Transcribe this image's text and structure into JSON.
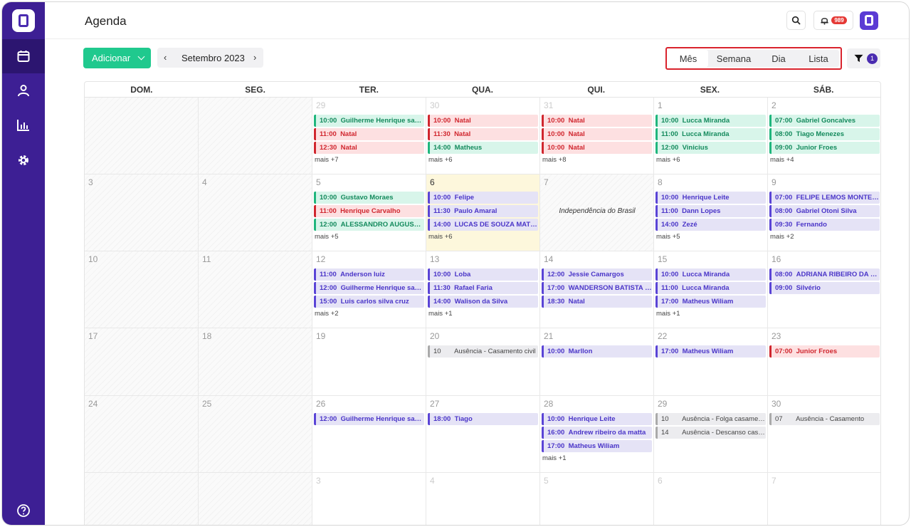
{
  "app": {
    "title": "Agenda"
  },
  "header": {
    "notification_count": "989"
  },
  "toolbar": {
    "add_label": "Adicionar",
    "month_label": "Setembro 2023",
    "prev": "‹",
    "next": "›",
    "filter_count": "1"
  },
  "views": [
    {
      "label": "Mês",
      "active": true
    },
    {
      "label": "Semana"
    },
    {
      "label": "Dia"
    },
    {
      "label": "Lista"
    }
  ],
  "calendar": {
    "weekdays": [
      "DOM.",
      "SEG.",
      "TER.",
      "QUA.",
      "QUI.",
      "SEX.",
      "SÁB."
    ],
    "weeks": [
      {
        "days": [
          {
            "num": "",
            "off": true
          },
          {
            "num": "",
            "off": true
          },
          {
            "num": "29",
            "muted": true,
            "events": [
              {
                "time": "10:00",
                "title": "Guilherme Henrique santos",
                "color": "green"
              },
              {
                "time": "11:00",
                "title": "Natal",
                "color": "red"
              },
              {
                "time": "12:30",
                "title": "Natal",
                "color": "red"
              }
            ],
            "more": "mais +7"
          },
          {
            "num": "30",
            "muted": true,
            "events": [
              {
                "time": "10:00",
                "title": "Natal",
                "color": "red"
              },
              {
                "time": "11:30",
                "title": "Natal",
                "color": "red"
              },
              {
                "time": "14:00",
                "title": "Matheus",
                "color": "green"
              }
            ],
            "more": "mais +6"
          },
          {
            "num": "31",
            "muted": true,
            "events": [
              {
                "time": "10:00",
                "title": "Natal",
                "color": "red"
              },
              {
                "time": "10:00",
                "title": "Natal",
                "color": "red"
              },
              {
                "time": "10:00",
                "title": "Natal",
                "color": "red"
              }
            ],
            "more": "mais +8"
          },
          {
            "num": "1",
            "events": [
              {
                "time": "10:00",
                "title": "Lucca Miranda",
                "color": "green"
              },
              {
                "time": "11:00",
                "title": "Lucca Miranda",
                "color": "green"
              },
              {
                "time": "12:00",
                "title": "Vinicius",
                "color": "green"
              }
            ],
            "more": "mais +6"
          },
          {
            "num": "2",
            "events": [
              {
                "time": "07:00",
                "title": "Gabriel Goncalves",
                "color": "green"
              },
              {
                "time": "08:00",
                "title": "Tiago Menezes",
                "color": "green"
              },
              {
                "time": "09:00",
                "title": "Junior Froes",
                "color": "green"
              }
            ],
            "more": "mais +4"
          }
        ]
      },
      {
        "days": [
          {
            "num": "3",
            "off": true
          },
          {
            "num": "4",
            "off": true
          },
          {
            "num": "5",
            "events": [
              {
                "time": "10:00",
                "title": "Gustavo Moraes",
                "color": "green"
              },
              {
                "time": "11:00",
                "title": "Henrique Carvalho",
                "color": "red"
              },
              {
                "time": "12:00",
                "title": "ALESSANDRO AUGUSTO ...",
                "color": "green"
              }
            ],
            "more": "mais +5"
          },
          {
            "num": "6",
            "today": true,
            "events": [
              {
                "time": "10:00",
                "title": "Felipe",
                "color": "purple"
              },
              {
                "time": "11:30",
                "title": "Paulo Amaral",
                "color": "purple"
              },
              {
                "time": "14:00",
                "title": "LUCAS DE SOUZA MATTOS",
                "color": "purple"
              }
            ],
            "more": "mais +6"
          },
          {
            "num": "7",
            "off": true,
            "holiday": "Independência do Brasil"
          },
          {
            "num": "8",
            "events": [
              {
                "time": "10:00",
                "title": "Henrique Leite",
                "color": "purple"
              },
              {
                "time": "11:00",
                "title": "Dann Lopes",
                "color": "purple"
              },
              {
                "time": "14:00",
                "title": "Zezé",
                "color": "purple"
              }
            ],
            "more": "mais +5"
          },
          {
            "num": "9",
            "events": [
              {
                "time": "07:00",
                "title": "FELIPE LEMOS MONTEIRO",
                "color": "purple"
              },
              {
                "time": "08:00",
                "title": "Gabriel Otoni Silva",
                "color": "purple"
              },
              {
                "time": "09:30",
                "title": "Fernando",
                "color": "purple"
              }
            ],
            "more": "mais +2"
          }
        ]
      },
      {
        "days": [
          {
            "num": "10",
            "off": true
          },
          {
            "num": "11",
            "off": true
          },
          {
            "num": "12",
            "events": [
              {
                "time": "11:00",
                "title": "Anderson luiz",
                "color": "purple"
              },
              {
                "time": "12:00",
                "title": "Guilherme Henrique santos",
                "color": "purple"
              },
              {
                "time": "15:00",
                "title": "Luis carlos silva cruz",
                "color": "purple"
              }
            ],
            "more": "mais +2"
          },
          {
            "num": "13",
            "events": [
              {
                "time": "10:00",
                "title": "Loba",
                "color": "purple"
              },
              {
                "time": "11:30",
                "title": "Rafael Faria",
                "color": "purple"
              },
              {
                "time": "14:00",
                "title": "Walison da Silva",
                "color": "purple"
              }
            ],
            "more": "mais +1"
          },
          {
            "num": "14",
            "events": [
              {
                "time": "12:00",
                "title": "Jessie Camargos",
                "color": "purple"
              },
              {
                "time": "17:00",
                "title": "WANDERSON BATISTA D...",
                "color": "purple"
              },
              {
                "time": "18:30",
                "title": "Natal",
                "color": "purple"
              }
            ]
          },
          {
            "num": "15",
            "events": [
              {
                "time": "10:00",
                "title": "Lucca Miranda",
                "color": "purple"
              },
              {
                "time": "11:00",
                "title": "Lucca Miranda",
                "color": "purple"
              },
              {
                "time": "17:00",
                "title": "Matheus Wiliam",
                "color": "purple"
              }
            ],
            "more": "mais +1"
          },
          {
            "num": "16",
            "events": [
              {
                "time": "08:00",
                "title": "ADRIANA RIBEIRO DA MA...",
                "color": "purple"
              },
              {
                "time": "09:00",
                "title": "Silvério",
                "color": "purple"
              }
            ]
          }
        ]
      },
      {
        "days": [
          {
            "num": "17",
            "off": true
          },
          {
            "num": "18",
            "off": true
          },
          {
            "num": "19"
          },
          {
            "num": "20",
            "events": [
              {
                "time": "10",
                "title": "Ausência - Casamento civil",
                "color": "gray"
              }
            ]
          },
          {
            "num": "21",
            "events": [
              {
                "time": "10:00",
                "title": "Marllon",
                "color": "purple"
              }
            ]
          },
          {
            "num": "22",
            "events": [
              {
                "time": "17:00",
                "title": "Matheus Wiliam",
                "color": "purple"
              }
            ]
          },
          {
            "num": "23",
            "events": [
              {
                "time": "07:00",
                "title": "Junior Froes",
                "color": "red"
              }
            ]
          }
        ]
      },
      {
        "days": [
          {
            "num": "24",
            "off": true
          },
          {
            "num": "25",
            "off": true
          },
          {
            "num": "26",
            "events": [
              {
                "time": "12:00",
                "title": "Guilherme Henrique santos",
                "color": "purple"
              }
            ]
          },
          {
            "num": "27",
            "events": [
              {
                "time": "18:00",
                "title": "Tiago",
                "color": "purple"
              }
            ]
          },
          {
            "num": "28",
            "events": [
              {
                "time": "10:00",
                "title": "Henrique Leite",
                "color": "purple"
              },
              {
                "time": "16:00",
                "title": "Andrew ribeiro da matta",
                "color": "purple"
              },
              {
                "time": "17:00",
                "title": "Matheus Wiliam",
                "color": "purple"
              }
            ],
            "more": "mais +1"
          },
          {
            "num": "29",
            "events": [
              {
                "time": "10",
                "title": "Ausência - Folga casamento",
                "color": "gray"
              },
              {
                "time": "14",
                "title": "Ausência - Descanso casamento",
                "color": "gray"
              }
            ]
          },
          {
            "num": "30",
            "events": [
              {
                "time": "07",
                "title": "Ausência - Casamento",
                "color": "gray"
              }
            ]
          }
        ]
      },
      {
        "days": [
          {
            "num": "",
            "off": true
          },
          {
            "num": "",
            "off": true
          },
          {
            "num": "3",
            "muted": true
          },
          {
            "num": "4",
            "muted": true
          },
          {
            "num": "5",
            "muted": true
          },
          {
            "num": "6",
            "muted": true
          },
          {
            "num": "7",
            "muted": true
          }
        ]
      }
    ]
  },
  "colors": {
    "sidebar": "#3d1f94",
    "primary": "#20c98e",
    "accent": "#5a44d6",
    "danger": "#d9232d"
  }
}
